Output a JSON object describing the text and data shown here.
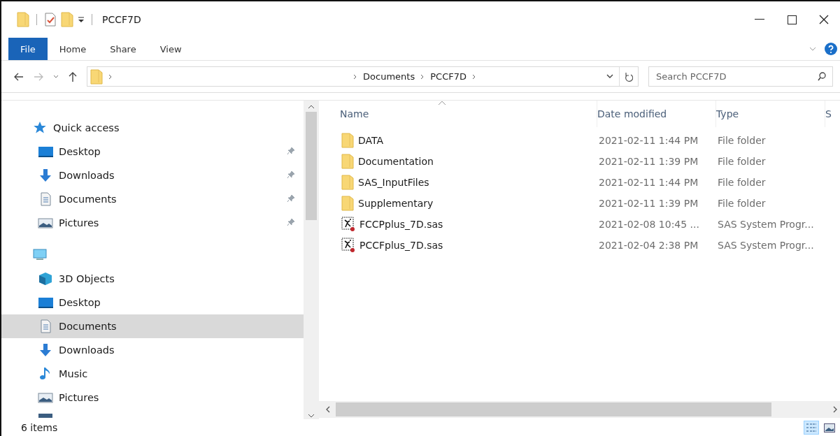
{
  "window": {
    "title": "PCCF7D"
  },
  "ribbon": {
    "tabs": [
      {
        "label": "File",
        "kind": "file",
        "selected": false
      },
      {
        "label": "Home",
        "kind": "tab",
        "selected": false
      },
      {
        "label": "Share",
        "kind": "tab",
        "selected": false
      },
      {
        "label": "View",
        "kind": "tab",
        "selected": false
      }
    ]
  },
  "address_bar": {
    "crumbs": [
      "Documents",
      "PCCF7D"
    ]
  },
  "search": {
    "placeholder": "Search PCCF7D"
  },
  "navigation": [
    {
      "label": "Quick access",
      "kind": "star",
      "children": [
        {
          "label": "Desktop",
          "kind": "desktop",
          "pinned": true,
          "selected": false
        },
        {
          "label": "Downloads",
          "kind": "download",
          "pinned": true,
          "selected": false
        },
        {
          "label": "Documents",
          "kind": "document",
          "pinned": true,
          "selected": false
        },
        {
          "label": "Pictures",
          "kind": "picture",
          "pinned": true,
          "selected": false
        }
      ]
    },
    {
      "kind": "pc",
      "children": [
        {
          "label": "3D Objects",
          "kind": "cube",
          "pinned": false,
          "selected": false
        },
        {
          "label": "Desktop",
          "kind": "desktop",
          "pinned": false,
          "selected": false
        },
        {
          "label": "Documents",
          "kind": "document",
          "pinned": false,
          "selected": true
        },
        {
          "label": "Downloads",
          "kind": "download",
          "pinned": false,
          "selected": false
        },
        {
          "label": "Music",
          "kind": "music",
          "pinned": false,
          "selected": false
        },
        {
          "label": "Pictures",
          "kind": "picture",
          "pinned": false,
          "selected": false
        },
        {
          "kind": "video",
          "pinned": false,
          "selected": false
        }
      ]
    }
  ],
  "file_list": {
    "columns": [
      "Name",
      "Date modified",
      "Type",
      "S"
    ],
    "rows": [
      {
        "name": "DATA",
        "date": "2021-02-11 1:44 PM",
        "type": "File folder",
        "kind": "folder"
      },
      {
        "name": "Documentation",
        "date": "2021-02-11 1:39 PM",
        "type": "File folder",
        "kind": "folder"
      },
      {
        "name": "SAS_InputFiles",
        "date": "2021-02-11 1:44 PM",
        "type": "File folder",
        "kind": "folder"
      },
      {
        "name": "Supplementary",
        "date": "2021-02-11 1:39 PM",
        "type": "File folder",
        "kind": "folder"
      },
      {
        "name": "FCCPplus_7D.sas",
        "date": "2021-02-08 10:45 ...",
        "type": "SAS System Progr...",
        "kind": "sas"
      },
      {
        "name": "PCCFplus_7D.sas",
        "date": "2021-02-04 2:38 PM",
        "type": "SAS System Progr...",
        "kind": "sas"
      }
    ]
  },
  "status_bar": {
    "item_count": "6 items",
    "views": [
      {
        "kind": "details",
        "selected": true
      },
      {
        "kind": "large_icons",
        "selected": false
      }
    ]
  }
}
